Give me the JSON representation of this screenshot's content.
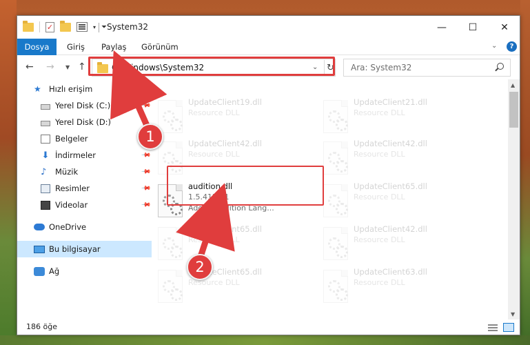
{
  "window": {
    "title": "System32",
    "controls": {
      "minimize": "—",
      "maximize": "☐",
      "close": "✕"
    }
  },
  "ribbon": {
    "tabs": [
      "Dosya",
      "Giriş",
      "Paylaş",
      "Görünüm"
    ],
    "expand_icon": "chevron-down-icon",
    "help_icon": "?"
  },
  "navigation": {
    "address": "C:\\Windows\\System32",
    "search_placeholder": "Ara: System32"
  },
  "sidebar": {
    "items": [
      {
        "label": "Hızlı erişim",
        "icon": "star-icon",
        "pinned": false
      },
      {
        "label": "Yerel Disk (C:)",
        "icon": "drive-icon",
        "pinned": true
      },
      {
        "label": "Yerel Disk (D:)",
        "icon": "drive-icon",
        "pinned": false
      },
      {
        "label": "Belgeler",
        "icon": "document-icon",
        "pinned": true
      },
      {
        "label": "İndirmeler",
        "icon": "download-icon",
        "pinned": true
      },
      {
        "label": "Müzik",
        "icon": "music-icon",
        "pinned": true
      },
      {
        "label": "Resimler",
        "icon": "pictures-icon",
        "pinned": true
      },
      {
        "label": "Videolar",
        "icon": "video-icon",
        "pinned": true
      },
      {
        "label": "OneDrive",
        "icon": "cloud-icon",
        "pinned": false
      },
      {
        "label": "Bu bilgisayar",
        "icon": "computer-icon",
        "pinned": false,
        "selected": true
      },
      {
        "label": "Ağ",
        "icon": "network-icon",
        "pinned": false
      }
    ]
  },
  "files": [
    {
      "name": "UpdateClient19.dll",
      "type": "Resource DLL",
      "faded": true
    },
    {
      "name": "UpdateClient21.dll",
      "type": "Resource DLL",
      "faded": true
    },
    {
      "name": "UpdateClient42.dll",
      "type": "Resource DLL",
      "faded": true
    },
    {
      "name": "UpdateClient42.dll",
      "type": "Resource DLL",
      "faded": true
    },
    {
      "name": "audition.dll",
      "version": "1.5.4124.1",
      "description": "Adobe Audition Lang...",
      "faded": false
    },
    {
      "name": "UpdateClient65.dll",
      "type": "Resource DLL",
      "faded": true
    },
    {
      "name": "UpdateClient65.dll",
      "type": "Resource DLL",
      "faded": true
    },
    {
      "name": "UpdateClient42.dll",
      "type": "Resource DLL",
      "faded": true
    },
    {
      "name": "UpdateClient65.dll",
      "type": "Resource DLL",
      "faded": true
    },
    {
      "name": "UpdateClient63.dll",
      "type": "Resource DLL",
      "faded": true
    }
  ],
  "status": {
    "item_count": "186 öğe"
  },
  "annotations": {
    "step1": "1",
    "step2": "2",
    "color": "#e03d3d"
  }
}
